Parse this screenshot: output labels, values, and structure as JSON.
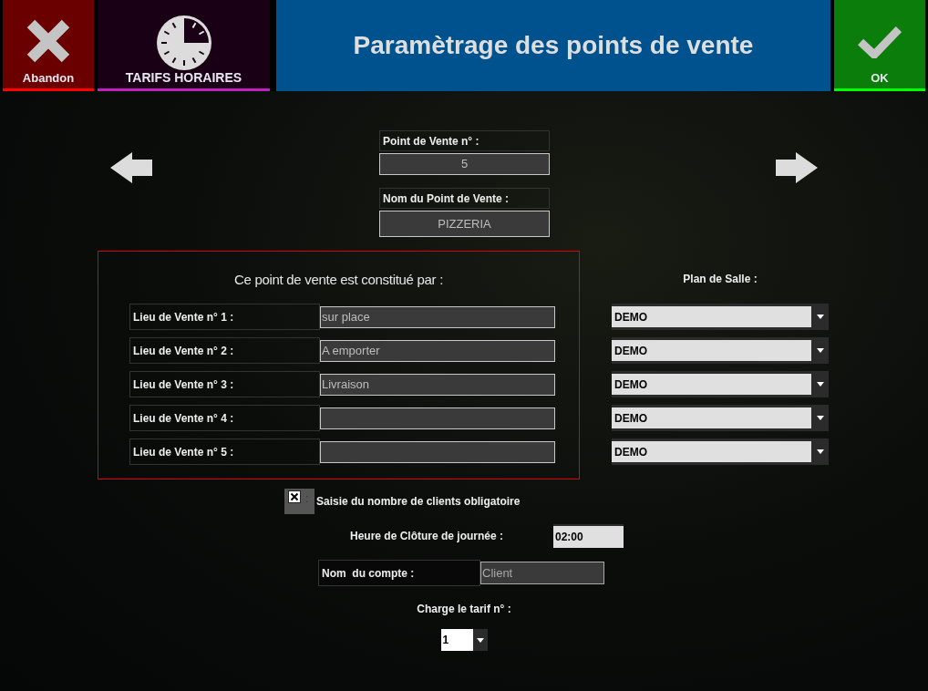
{
  "header": {
    "cancel_button": "Abandon",
    "schedule_button": "TARIFS HORAIRES",
    "title": "Paramètrage des points de vente",
    "ok_button": "OK"
  },
  "point_of_sale": {
    "number_label": "Point de Vente n° :",
    "number_value": "5",
    "name_label": "Nom du Point de Vente :",
    "name_value": "PIZZERIA"
  },
  "sales_places": {
    "heading": "Ce point de vente est constitué par :",
    "rows": [
      {
        "label": "Lieu de Vente n° 1 :",
        "value": "sur place"
      },
      {
        "label": "Lieu de Vente n° 2 :",
        "value": "A emporter"
      },
      {
        "label": "Lieu de Vente n° 3 :",
        "value": "Livraison"
      },
      {
        "label": "Lieu de Vente n° 4 :"
      },
      {
        "label": "Lieu de Vente n° 5 :"
      }
    ]
  },
  "floor_plan": {
    "heading": "Plan de Salle :",
    "selects": [
      "DEMO",
      "DEMO",
      "DEMO",
      "DEMO",
      "DEMO"
    ]
  },
  "guest_count_required": {
    "checked": true,
    "separator": ":",
    "label": "Saisie du nombre de clients obligatoire"
  },
  "closing_time": {
    "label": "Heure de Clôture de journée :",
    "value": "02:00"
  },
  "account_name": {
    "label": "Nom  du compte :",
    "value": "Client"
  },
  "tariff": {
    "label": "Charge le tarif n° :",
    "value": "1"
  }
}
